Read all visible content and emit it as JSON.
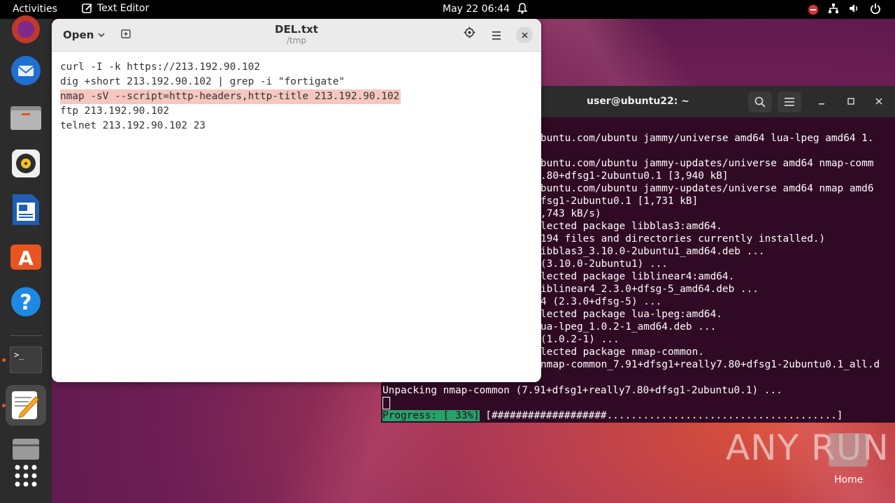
{
  "topbar": {
    "activities": "Activities",
    "app_name": "Text Editor",
    "clock": "May 22  06:44"
  },
  "dock": {
    "items": [
      {
        "name": "firefox-icon"
      },
      {
        "name": "thunderbird-icon"
      },
      {
        "name": "files-icon"
      },
      {
        "name": "rhythmbox-icon"
      },
      {
        "name": "writer-icon"
      },
      {
        "name": "software-icon"
      },
      {
        "name": "help-icon"
      },
      {
        "name": "terminal-icon"
      },
      {
        "name": "text-editor-icon"
      },
      {
        "name": "drive-icon"
      },
      {
        "name": "apps-grid-icon"
      }
    ]
  },
  "editor": {
    "open_label": "Open",
    "title": "DEL.txt",
    "subtitle": "/tmp",
    "lines": [
      "curl -I -k https://213.192.90.102",
      "dig +short 213.192.90.102 | grep -i \"fortigate\"",
      "nmap -sV --script=http-headers,http-title 213.192.90.102",
      "ftp 213.192.90.102",
      "telnet 213.192.90.102 23"
    ]
  },
  "terminal": {
    "title": "user@ubuntu22: ~",
    "lines": [
      "buntu.com/ubuntu jammy/universe amd64 lua-lpeg amd64 1.",
      "",
      "buntu.com/ubuntu jammy-updates/universe amd64 nmap-comm",
      ".80+dfsg1-2ubuntu0.1 [3,940 kB]",
      "buntu.com/ubuntu jammy-updates/universe amd64 nmap amd6",
      "fsg1-2ubuntu0.1 [1,731 kB]",
      ",743 kB/s)",
      "lected package libblas3:amd64.",
      "194 files and directories currently installed.)",
      "ibblas3_3.10.0-2ubuntu1_amd64.deb ...",
      "(3.10.0-2ubuntu1) ...",
      "lected package liblinear4:amd64.",
      "iblinear4_2.3.0+dfsg-5_amd64.deb ...",
      "4 (2.3.0+dfsg-5) ...",
      "lected package lua-lpeg:amd64.",
      "ua-lpeg_1.0.2-1_amd64.deb ...",
      "(1.0.2-1) ...",
      "lected package nmap-common.",
      "nmap-common_7.91+dfsg1+really7.80+dfsg1-2ubuntu0.1_all.d"
    ],
    "unpacking_line": "Unpacking nmap-common (7.91+dfsg1+really7.80+dfsg1-2ubuntu0.1) ...",
    "progress_label": "Progress: [ 33%]",
    "progress_bar": " [###################......................................]",
    "progress_percent": 33
  },
  "desktop": {
    "watermark": "ANY RUN",
    "home_label": "Home"
  },
  "colors": {
    "terminal_bg": "#300a24",
    "highlight": "#f6c7bf",
    "progress": "#26a269",
    "accent": "#e95420"
  }
}
